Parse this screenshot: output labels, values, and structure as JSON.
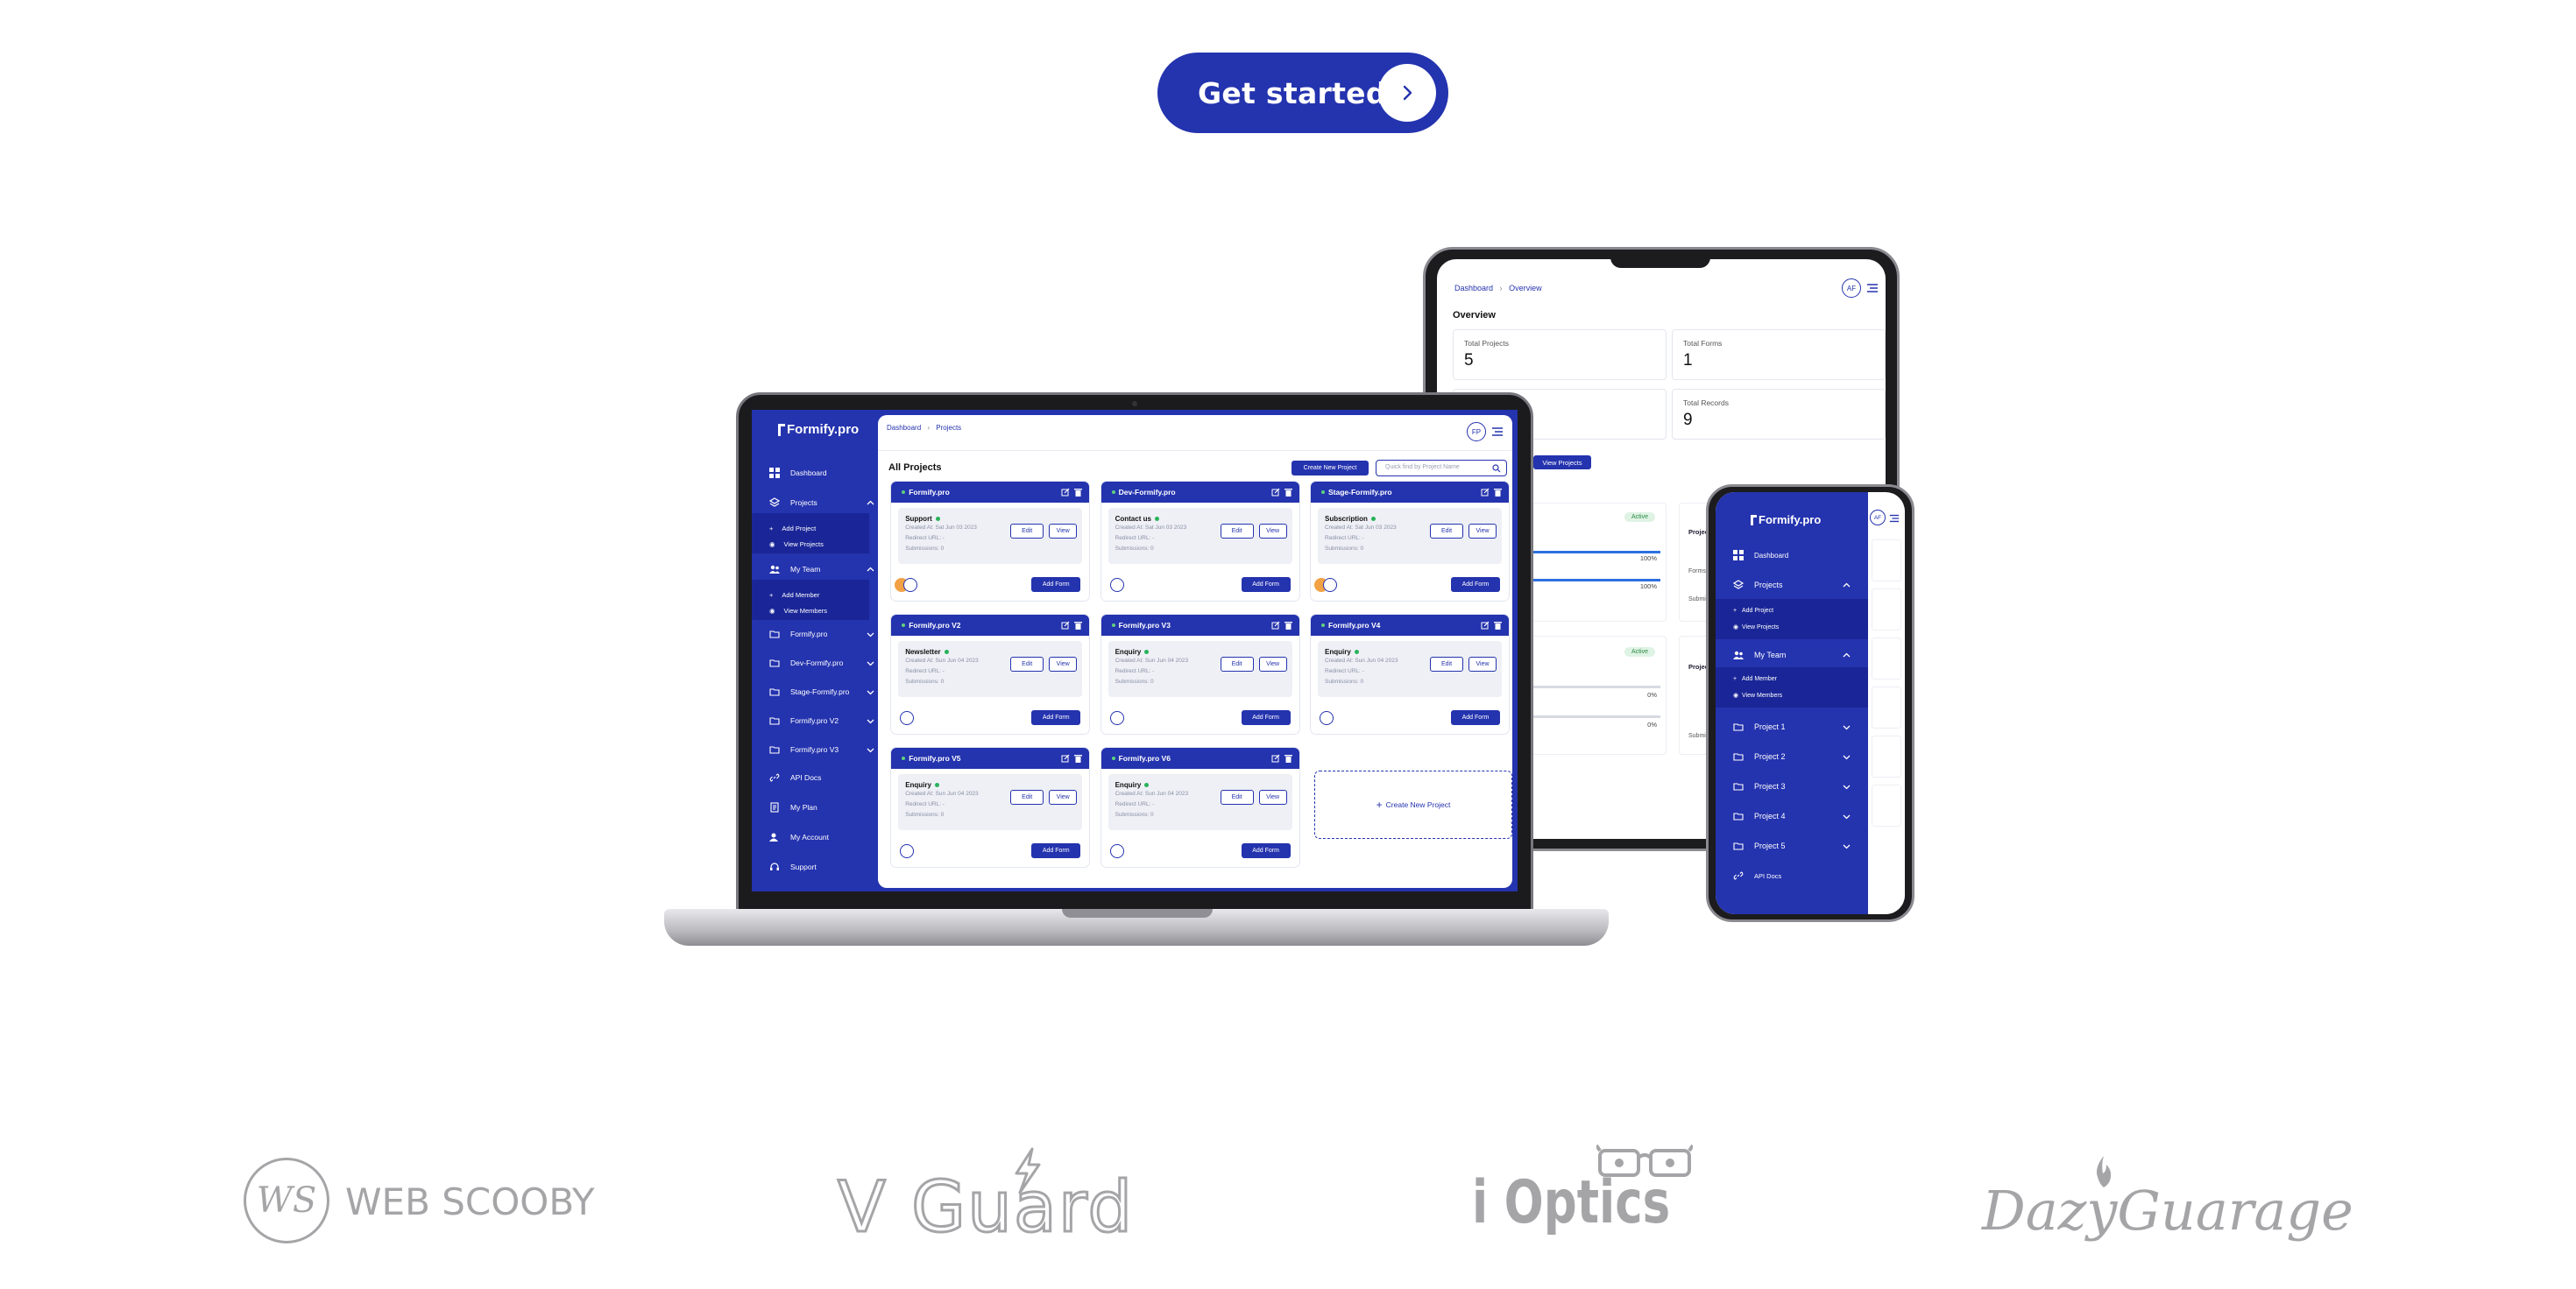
{
  "cta": {
    "label": "Get started"
  },
  "laptop": {
    "brand": "Formify.pro",
    "breadcrumb": {
      "first": "Dashboard",
      "second": "Projects"
    },
    "avatar": "FP",
    "page_title": "All Projects",
    "create_button": "Create New Project",
    "search_placeholder": "Quick find by Project Name",
    "sidebar": {
      "dashboard": "Dashboard",
      "projects": "Projects",
      "add_project": "Add Project",
      "view_projects": "View Projects",
      "my_team": "My Team",
      "add_member": "Add Member",
      "view_members": "View Members",
      "p1": "Formify.pro",
      "p2": "Dev-Formify.pro",
      "p3": "Stage-Formify.pro",
      "p4": "Formify.pro V2",
      "p5": "Formify.pro V3",
      "api_docs": "API Docs",
      "my_plan": "My Plan",
      "my_account": "My Account",
      "support": "Support"
    },
    "cards": [
      {
        "title": "Formify.pro",
        "form": "Support",
        "created": "Created At: Sat Jun 03 2023",
        "redirect": "Redirect URL: -",
        "subs": "Submissions: 0"
      },
      {
        "title": "Dev-Formify.pro",
        "form": "Contact us",
        "created": "Created At: Sat Jun 03 2023",
        "redirect": "Redirect URL: -",
        "subs": "Submissions: 0"
      },
      {
        "title": "Stage-Formify.pro",
        "form": "Subscription",
        "created": "Created At: Sat Jun 03 2023",
        "redirect": "Redirect URL: -",
        "subs": "Submissions: 0"
      },
      {
        "title": "Formify.pro V2",
        "form": "Newsletter",
        "created": "Created At: Sun Jun 04 2023",
        "redirect": "Redirect URL: -",
        "subs": "Submissions: 0"
      },
      {
        "title": "Formify.pro V3",
        "form": "Enquiry",
        "created": "Created At: Sun Jun 04 2023",
        "redirect": "Redirect URL: -",
        "subs": "Submissions: 0"
      },
      {
        "title": "Formify.pro V4",
        "form": "Enquiry",
        "created": "Created At: Sun Jun 04 2023",
        "redirect": "Redirect URL: -",
        "subs": "Submissions: 0"
      },
      {
        "title": "Formify.pro V5",
        "form": "Enquiry",
        "created": "Created At: Sun Jun 04 2023",
        "redirect": "Redirect URL: -",
        "subs": "Submissions: 0"
      },
      {
        "title": "Formify.pro V6",
        "form": "Enquiry",
        "created": "Created At: Sun Jun 04 2023",
        "redirect": "Redirect URL: -",
        "subs": "Submissions: 0"
      }
    ],
    "edit_label": "Edit",
    "view_label": "View",
    "add_form_label": "Add Form",
    "create_card_label": "Create New Project"
  },
  "tablet": {
    "breadcrumb": {
      "first": "Dashboard",
      "second": "Overview"
    },
    "avatar": "AF",
    "title": "Overview",
    "stats": [
      {
        "label": "Total Projects",
        "value": "5"
      },
      {
        "label": "Total Forms",
        "value": "1"
      },
      {
        "label": "Total Records",
        "value": "9"
      }
    ],
    "view_projects": "View Projects",
    "active_1": "Active",
    "active_2": "Active",
    "pct_1": "100%",
    "pct_2": "100%",
    "pct_3": "0%",
    "pct_4": "0%",
    "proj_label_1": "Projec",
    "proj_label_2": "Projec",
    "forms": "Forms",
    "submi_1": "Submi",
    "submi_2": "Submi"
  },
  "phone": {
    "brand": "Formify.pro",
    "avatar": "AF",
    "dashboard": "Dashboard",
    "projects": "Projects",
    "add_project": "Add Project",
    "view_projects": "View Projects",
    "my_team": "My Team",
    "add_member": "Add Member",
    "view_members": "View Members",
    "p1": "Project 1",
    "p2": "Project 2",
    "p3": "Project 3",
    "p4": "Project 4",
    "p5": "Project 5",
    "api_docs": "API Docs"
  },
  "logos": {
    "web_scooby": "WEB SCOOBY",
    "web_scooby_mark": "WS",
    "vguard": "V Guard",
    "ioptics": "i Optics",
    "dazy": "DazyGuarage"
  },
  "colors": {
    "brand": "#2433ae",
    "logo_grey": "#a5a5a8"
  }
}
